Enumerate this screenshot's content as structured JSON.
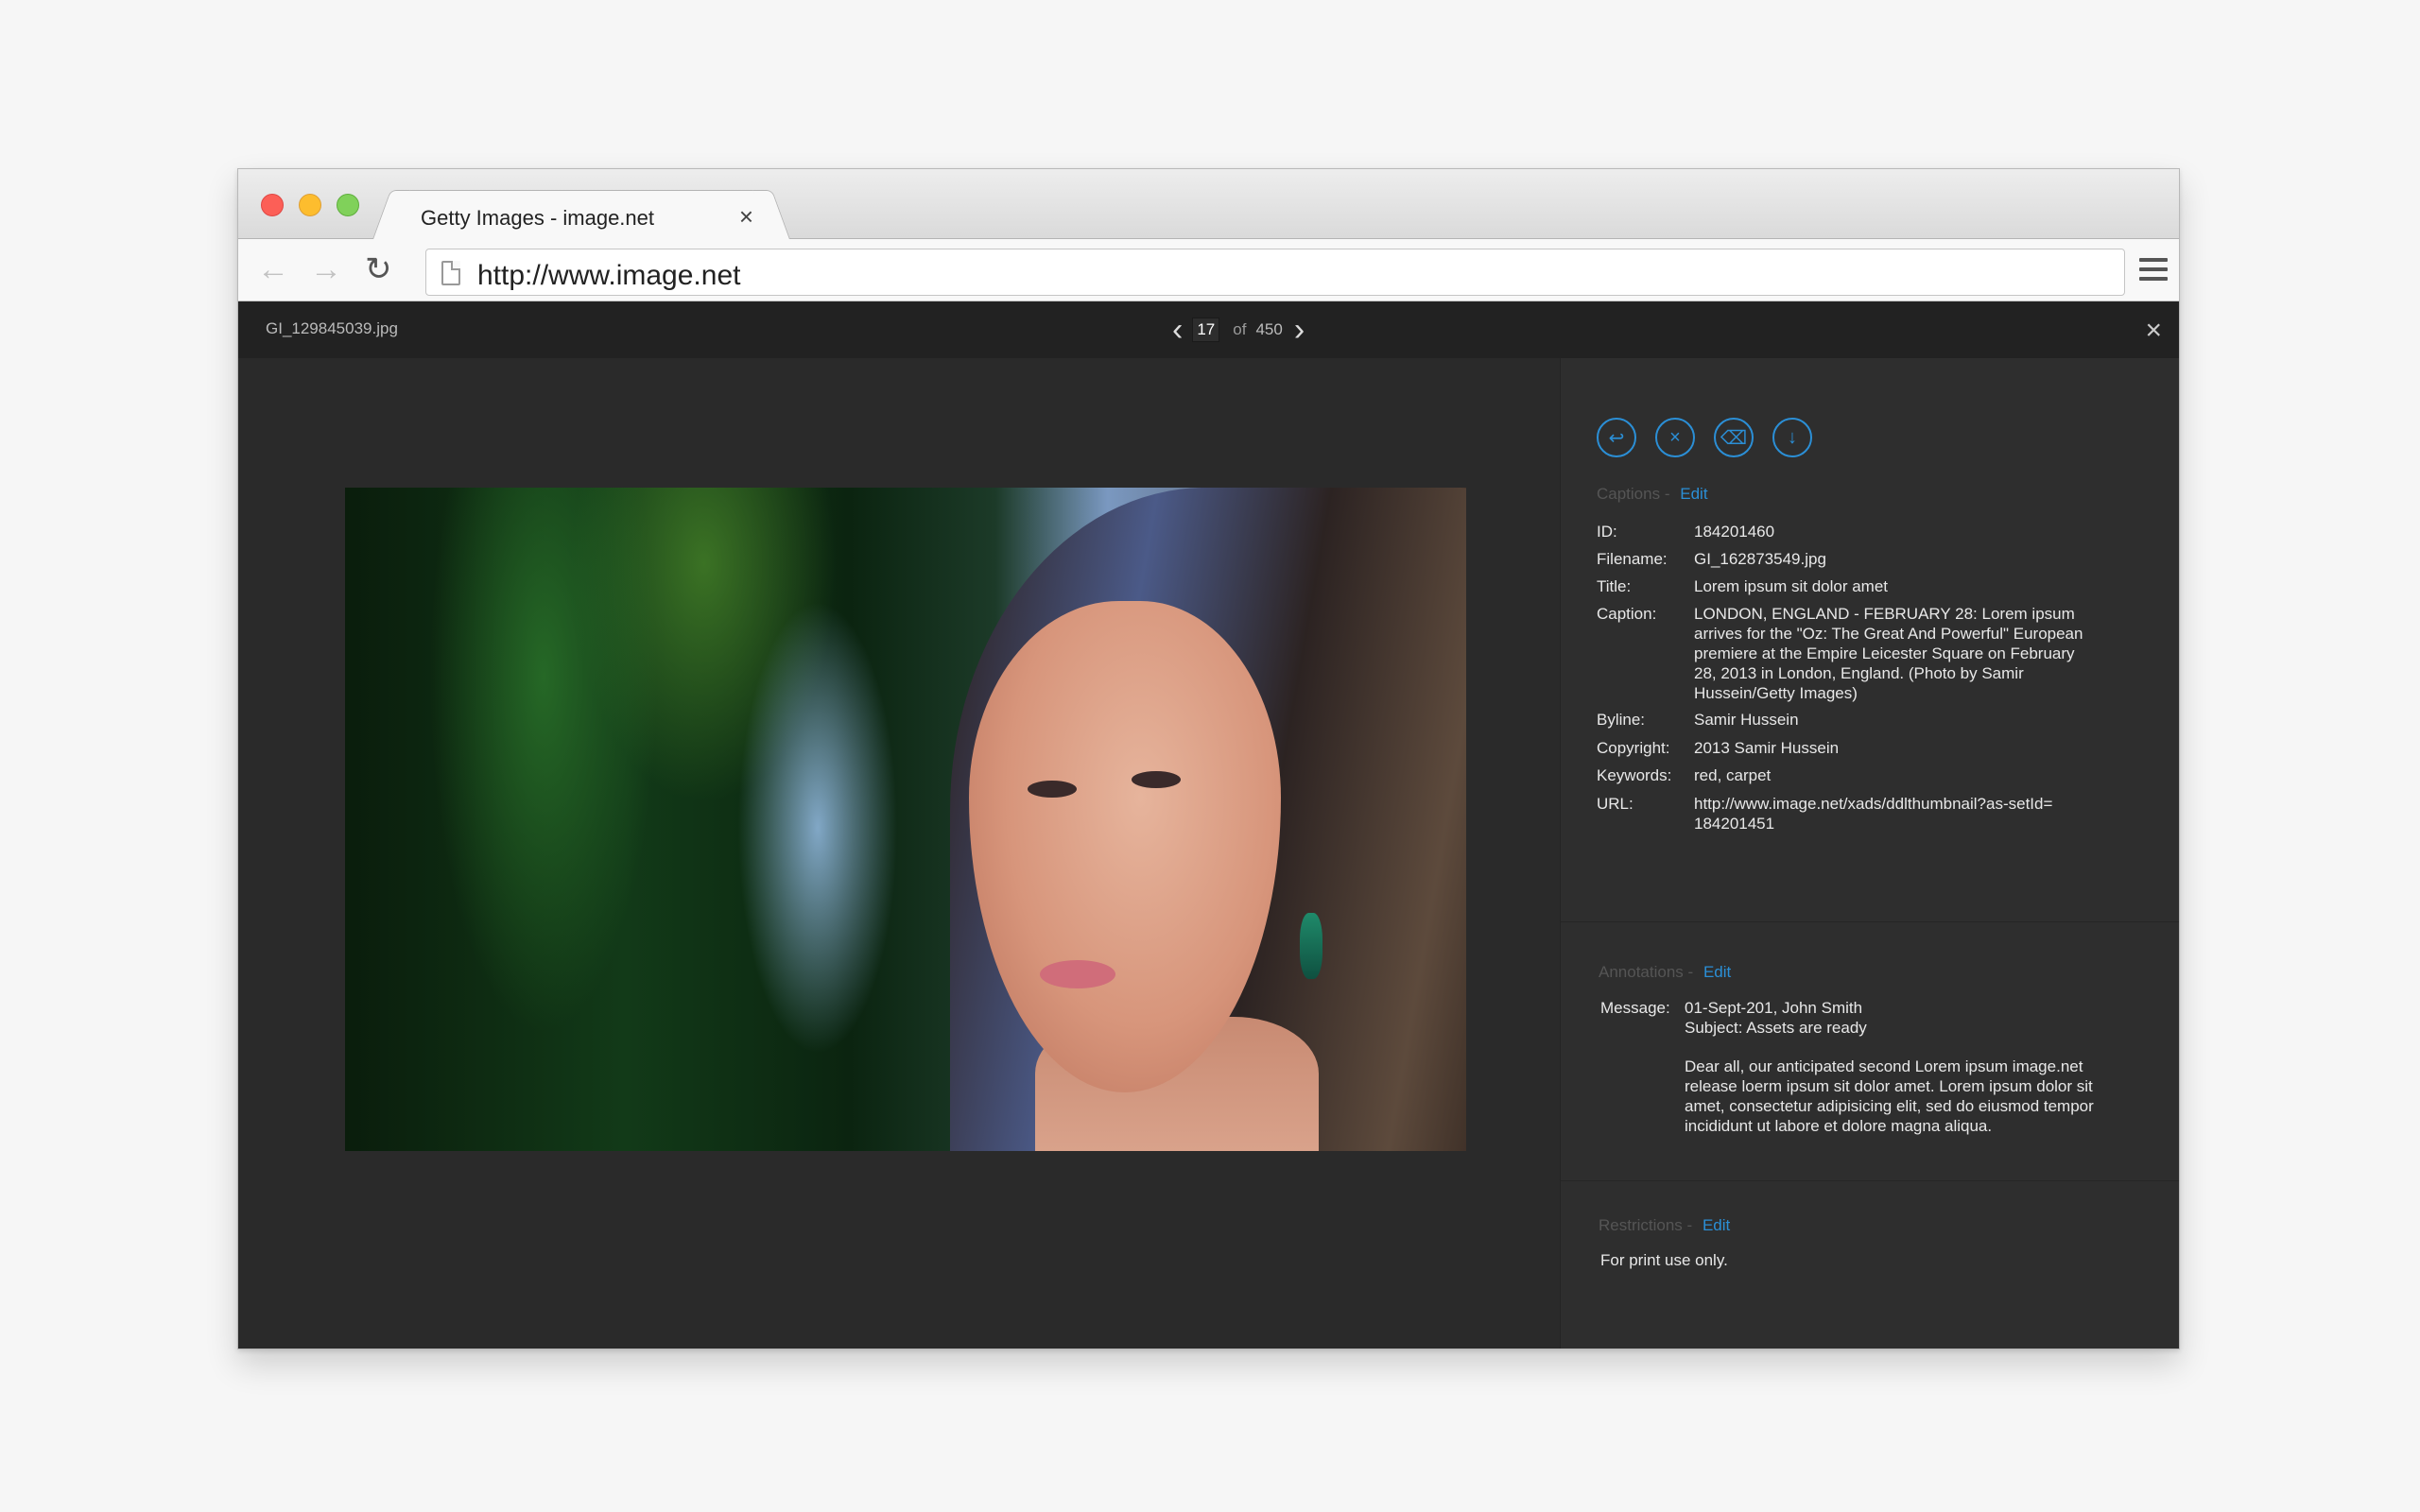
{
  "browser": {
    "tab_title": "Getty Images - image.net",
    "tab_close": "×",
    "url": "http://www.image.net"
  },
  "viewer": {
    "filename": "GI_129845039.jpg",
    "current_page": "17",
    "of_label": "of",
    "total_pages": "450",
    "prev": "‹",
    "next": "›",
    "close": "×"
  },
  "actions": [
    {
      "icon": "move-to-folder-icon"
    },
    {
      "icon": "remove-from-folder-icon"
    },
    {
      "icon": "trash-icon"
    },
    {
      "icon": "download-icon"
    }
  ],
  "captions": {
    "heading": "Captions",
    "separator": "-",
    "edit": "Edit",
    "fields": [
      {
        "label": "ID:",
        "value": "184201460"
      },
      {
        "label": "Filename:",
        "value": "GI_162873549.jpg"
      },
      {
        "label": "Title:",
        "value": "Lorem ipsum sit dolor amet"
      },
      {
        "label": "Caption:",
        "value": "LONDON, ENGLAND - FEBRUARY 28: Lorem ipsum arrives for the \"Oz: The Great And Powerful\" European premiere at the Empire Leicester Square on February 28, 2013 in London, England. (Photo by Samir Hussein/Getty Images)"
      },
      {
        "label": "Byline:",
        "value": "Samir Hussein"
      },
      {
        "label": "Copyright:",
        "value": "2013 Samir Hussein"
      },
      {
        "label": "Keywords:",
        "value": "red, carpet"
      },
      {
        "label": "URL:",
        "value": "http://www.image.net/xads/ddlthumbnail?as-setId=184201451"
      }
    ]
  },
  "annotations": {
    "heading": "Annotations",
    "separator": "-",
    "edit": "Edit",
    "message_label": "Message:",
    "date_author": "01-Sept-201, John Smith",
    "subject": "Subject: Assets are ready",
    "body": "Dear all, our anticipated second Lorem ipsum image.net release loerm ipsum sit dolor amet. Lorem ipsum dolor sit amet, consectetur adipisicing elit, sed do eiusmod tempor incididunt ut labore et dolore magna aliqua."
  },
  "restrictions": {
    "heading": "Restrictions",
    "separator": "-",
    "edit": "Edit",
    "text": "For print use only."
  },
  "colors": {
    "accent": "#2b8fd6",
    "panel_bg": "#2e2e2e",
    "viewer_bar": "#222222"
  }
}
